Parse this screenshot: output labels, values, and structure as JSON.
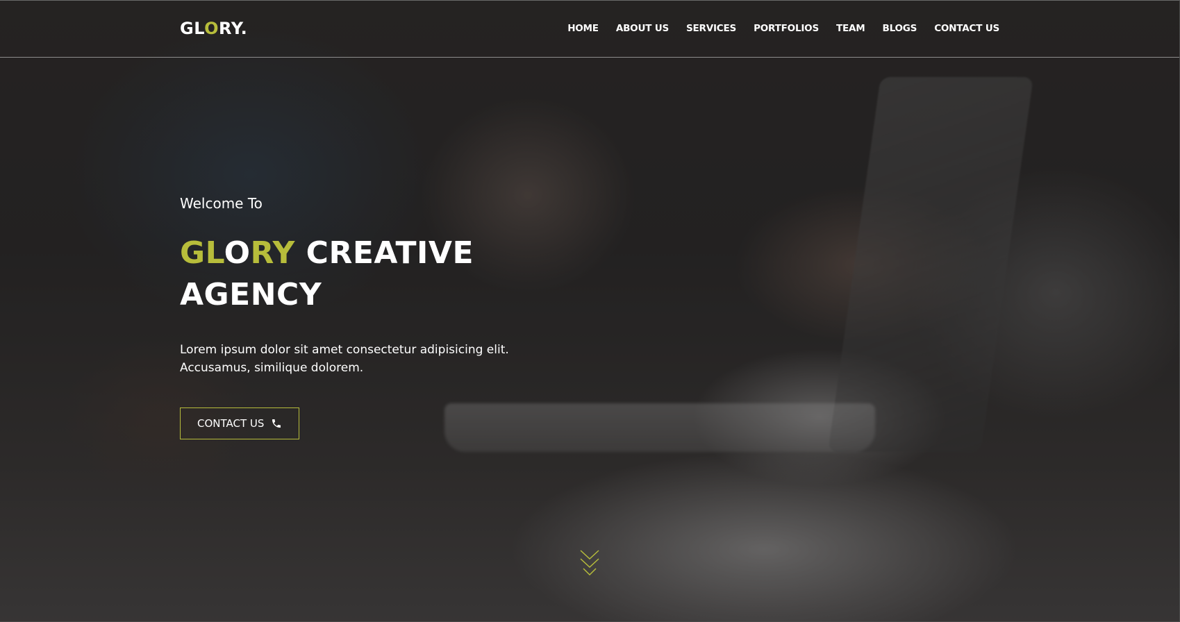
{
  "header": {
    "logo_parts": [
      "GL",
      "O",
      "RY."
    ],
    "nav": [
      "HOME",
      "ABOUT US",
      "SERVICES",
      "PORTFOLIOS",
      "TEAM",
      "BLOGS",
      "CONTACT US"
    ]
  },
  "hero": {
    "welcome": "Welcome To",
    "headline_parts": [
      "GL",
      "O",
      "RY",
      " CREATIVE",
      "AGENCY"
    ],
    "description_line1": "Lorem ipsum dolor sit amet consectetur adipisicing elit.",
    "description_line2": "Accusamus, similique dolorem.",
    "cta_label": "CONTACT US",
    "cta_icon": "phone-icon"
  },
  "scroll": {
    "icon": "chevrons-down-icon"
  },
  "colors": {
    "accent": "#b7bd3b",
    "text": "#ffffff"
  }
}
